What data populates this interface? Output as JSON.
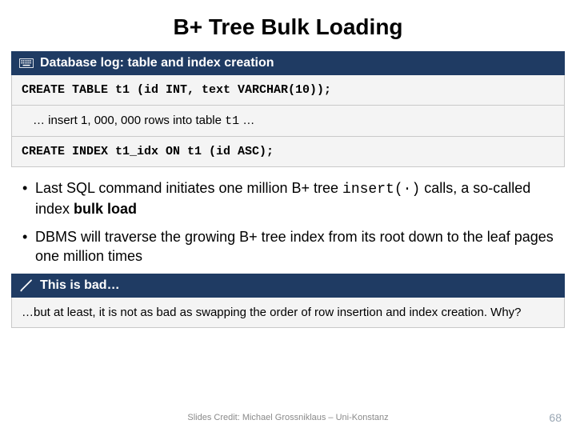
{
  "title": "B+ Tree Bulk Loading",
  "bar1": {
    "icon_name": "keyboard-icon",
    "label": "Database log: table and index creation"
  },
  "code1": "CREATE TABLE t1 (id INT, text VARCHAR(10));",
  "note_prefix": "… insert 1, 000, 000 rows into table ",
  "note_table": "t1",
  "note_suffix": " …",
  "code2": "CREATE INDEX t1_idx ON t1 (id ASC);",
  "bullet1_a": "Last SQL command initiates one million B+ tree ",
  "bullet1_code": "insert(·)",
  "bullet1_b": " calls, a so-called index ",
  "bullet1_bold": "bulk load",
  "bullet2": "DBMS will traverse the growing B+ tree index from its root down to the leaf pages one million times",
  "bar2": {
    "icon_name": "exclaim-icon",
    "label": "This is bad…"
  },
  "question": "…but at least, it is not as bad as swapping the order of row insertion and index creation. Why?",
  "footer_credit": "Slides Credit: Michael Grossniklaus – Uni-Konstanz",
  "page_number": "68"
}
